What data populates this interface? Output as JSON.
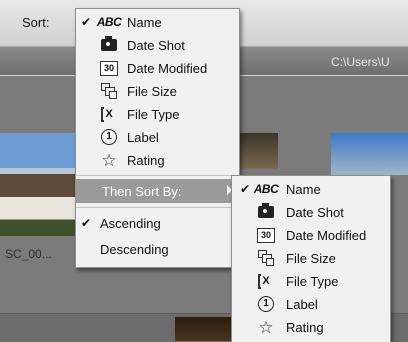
{
  "toolbar": {
    "sort_label": "Sort:"
  },
  "pathbar": {
    "path": "C:\\Users\\U"
  },
  "content": {
    "thumb_name": "SC_00..."
  },
  "sort_menu": {
    "items": [
      {
        "label": "Name",
        "icon": "abc-icon",
        "glyph": "ABC",
        "checked": true,
        "check": "✔"
      },
      {
        "label": "Date Shot",
        "icon": "camera-icon"
      },
      {
        "label": "Date Modified",
        "icon": "calendar-icon",
        "glyph": "30"
      },
      {
        "label": "File Size",
        "icon": "file-size-icon"
      },
      {
        "label": "File Type",
        "icon": "file-type-icon",
        "glyph": "X"
      },
      {
        "label": "Label",
        "icon": "label-icon",
        "glyph": "1"
      },
      {
        "label": "Rating",
        "icon": "star-icon",
        "glyph": "☆"
      }
    ],
    "then_sort_by": "Then Sort By:",
    "order": [
      {
        "label": "Ascending",
        "checked": true,
        "check": "✔"
      },
      {
        "label": "Descending"
      }
    ]
  },
  "then_sort_menu": {
    "items": [
      {
        "label": "Name",
        "icon": "abc-icon",
        "glyph": "ABC",
        "checked": true,
        "check": "✔"
      },
      {
        "label": "Date Shot",
        "icon": "camera-icon"
      },
      {
        "label": "Date Modified",
        "icon": "calendar-icon",
        "glyph": "30"
      },
      {
        "label": "File Size",
        "icon": "file-size-icon"
      },
      {
        "label": "File Type",
        "icon": "file-type-icon",
        "glyph": "X"
      },
      {
        "label": "Label",
        "icon": "label-icon",
        "glyph": "1"
      },
      {
        "label": "Rating",
        "icon": "star-icon",
        "glyph": "☆"
      }
    ]
  },
  "colors": {
    "menu_bg": "#f1f1f1",
    "highlight": "#9a9a9a",
    "toolbar": "#dcdcdc",
    "pathbar": "#7d7d7d"
  }
}
